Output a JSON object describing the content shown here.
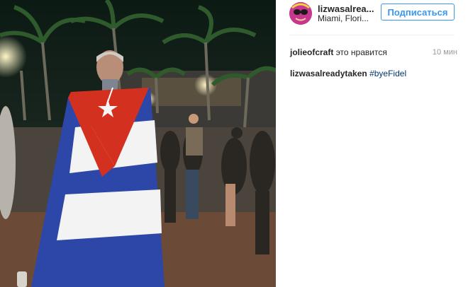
{
  "post": {
    "username": "lizwasalrea...",
    "location": "Miami, Flori...",
    "follow_label": "Подписаться",
    "image_alt": "Man wearing Cuban flag at night street gathering"
  },
  "comments": [
    {
      "user": "jolieofcraft",
      "text": "это нравится",
      "time": "10 мин"
    },
    {
      "user": "lizwasalreadytaken",
      "text": "#byeFidel"
    }
  ],
  "colors": {
    "accent": "#3897f0",
    "hashtag": "#003569"
  }
}
